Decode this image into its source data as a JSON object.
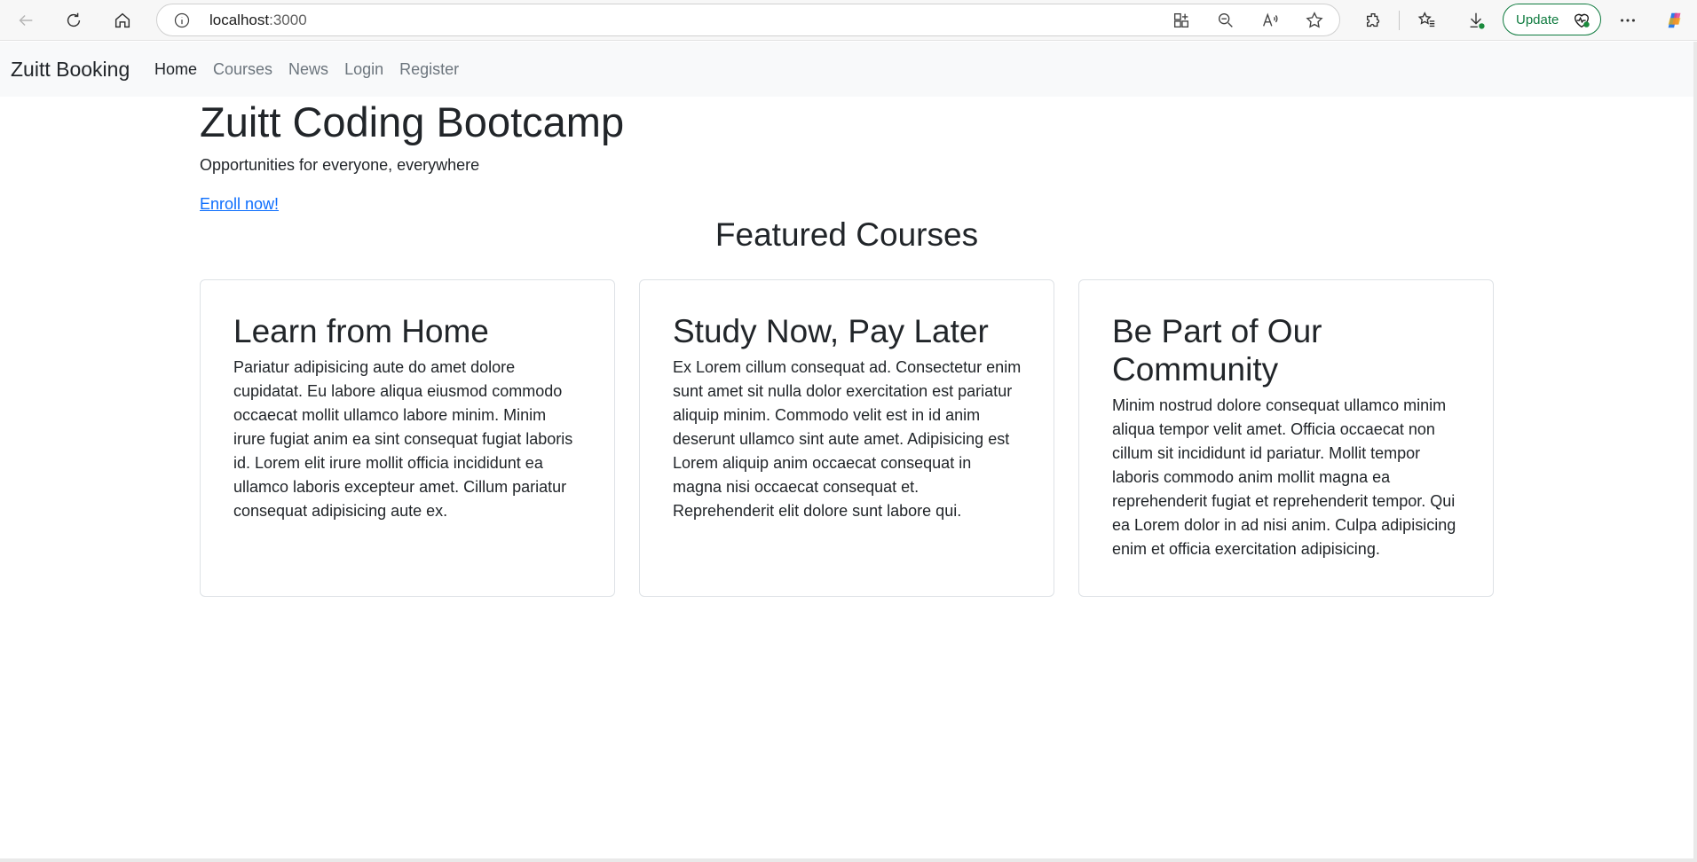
{
  "browser": {
    "url_host": "localhost",
    "url_port": ":3000",
    "update_label": "Update",
    "icons": [
      "back-icon",
      "reload-icon",
      "home-icon",
      "site-info-icon",
      "apps-icon",
      "zoom-out-icon",
      "read-aloud-icon",
      "favorite-star-icon",
      "extensions-icon",
      "favorites-icon",
      "downloads-icon",
      "health-heart-icon",
      "more-icon",
      "copilot-icon"
    ]
  },
  "navbar": {
    "brand": "Zuitt Booking",
    "links": [
      {
        "label": "Home",
        "active": true
      },
      {
        "label": "Courses"
      },
      {
        "label": "News"
      },
      {
        "label": "Login"
      },
      {
        "label": "Register"
      }
    ]
  },
  "hero": {
    "title": "Zuitt Coding Bootcamp",
    "subtitle": "Opportunities for everyone, everywhere",
    "cta": "Enroll now!"
  },
  "featured": {
    "heading": "Featured Courses",
    "cards": [
      {
        "title": "Learn from Home",
        "body": "Pariatur adipisicing aute do amet dolore cupidatat. Eu labore aliqua eiusmod commodo occaecat mollit ullamco labore minim. Minim irure fugiat anim ea sint consequat fugiat laboris id. Lorem elit irure mollit officia incididunt ea ullamco laboris excepteur amet. Cillum pariatur consequat adipisicing aute ex."
      },
      {
        "title": "Study Now, Pay Later",
        "body": "Ex Lorem cillum consequat ad. Consectetur enim sunt amet sit nulla dolor exercitation est pariatur aliquip minim. Commodo velit est in id anim deserunt ullamco sint aute amet. Adipisicing est Lorem aliquip anim occaecat consequat in magna nisi occaecat consequat et. Reprehenderit elit dolore sunt labore qui."
      },
      {
        "title": "Be Part of Our Community",
        "body": "Minim nostrud dolore consequat ullamco minim aliqua tempor velit amet. Officia occaecat non cillum sit incididunt id pariatur. Mollit tempor laboris commodo anim mollit magna ea reprehenderit fugiat et reprehenderit tempor. Qui ea Lorem dolor in ad nisi anim. Culpa adipisicing enim et officia exercitation adipisicing."
      }
    ]
  },
  "colors": {
    "link": "#0d6efd",
    "navbar_bg": "#f8f9fa",
    "update_green": "#0f7b3f"
  }
}
